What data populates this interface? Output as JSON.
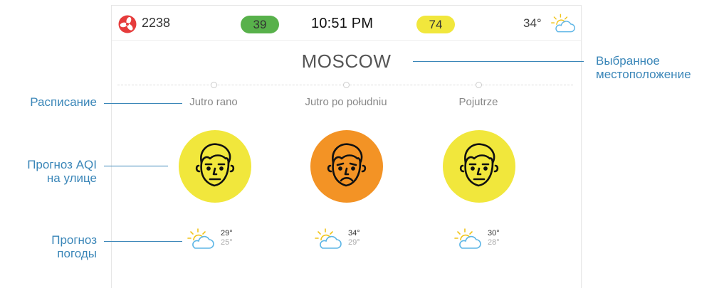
{
  "status_bar": {
    "fan_count": "2238",
    "aqi_green": "39",
    "time": "10:51 PM",
    "aqi_yellow": "74",
    "current_temp": "34°",
    "current_weather_icon": "partly-cloudy-icon"
  },
  "location": {
    "city": "MOSCOW"
  },
  "schedule": [
    {
      "label": "Jutro rano",
      "aqi_color": "#f1e73c",
      "face": "neutral-face-icon",
      "hi": "29°",
      "lo": "25°"
    },
    {
      "label": "Jutro po południu",
      "aqi_color": "#f39325",
      "face": "sad-face-icon",
      "hi": "34°",
      "lo": "29°"
    },
    {
      "label": "Pojutrze",
      "aqi_color": "#f1e73c",
      "face": "neutral-face-icon",
      "hi": "30°",
      "lo": "28°"
    }
  ],
  "annotations": {
    "selected_location_1": "Выбранное",
    "selected_location_2": "местоположение",
    "schedule": "Расписание",
    "aqi_forecast_1": "Прогноз AQI",
    "aqi_forecast_2": "на улице",
    "weather_forecast_1": "Прогноз",
    "weather_forecast_2": "погоды"
  },
  "colors": {
    "accent": "#3a86b8",
    "aqi_good": "#58b14b",
    "aqi_moderate": "#f1e73c",
    "aqi_unhealthy": "#f39325",
    "fan": "#e63c3c"
  }
}
